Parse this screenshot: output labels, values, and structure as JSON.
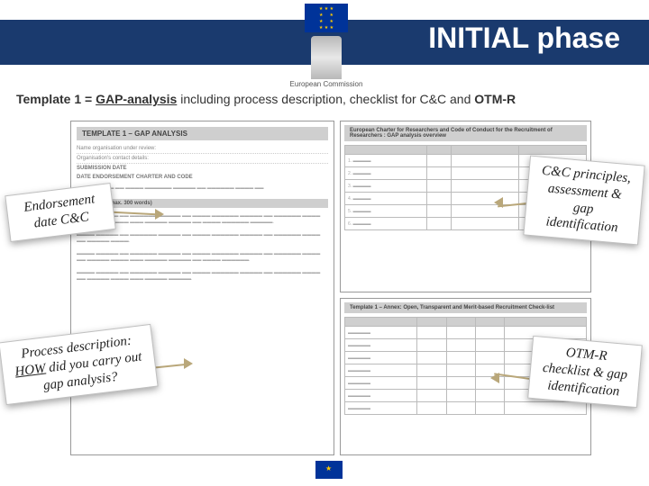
{
  "header": {
    "title": "INITIAL phase",
    "logo_label": "European\nCommission"
  },
  "subtitle": {
    "lead_bold": "Template 1 = ",
    "lead_underline": "GAP-analysis",
    "rest": " including process description, checklist for C&C and ",
    "tail_bold": "OTM-R"
  },
  "docs": {
    "left_title": "TEMPLATE 1 – GAP ANALYSIS",
    "left_name_label": "Name organisation under review:",
    "left_contact_label": "Organisation's contact details:",
    "left_sub_date": "SUBMISSION DATE",
    "left_sub_date2": "DATE ENDORSEMENT CHARTER AND CODE",
    "left_process_head": "PROCESS (max. 300 words)",
    "right_top_title": "European Charter for Researchers and Code of Conduct for the Recruitment of Researchers : GAP analysis overview",
    "right_bot_title": "Template 1 – Annex: Open, Transparent and Merit-based Recruitment Check-list"
  },
  "callouts": {
    "c1": "Endorsement date C&C",
    "c2": "Process description: HOW did you carry out gap analysis?",
    "c2_how": "HOW",
    "c3": "C&C principles, assessment & gap identification",
    "c4": "OTM-R checklist & gap identification"
  },
  "table_principle_rows": [
    "1.",
    "2.",
    "3.",
    "4.",
    "5.",
    "6."
  ],
  "otm_rows": 7
}
